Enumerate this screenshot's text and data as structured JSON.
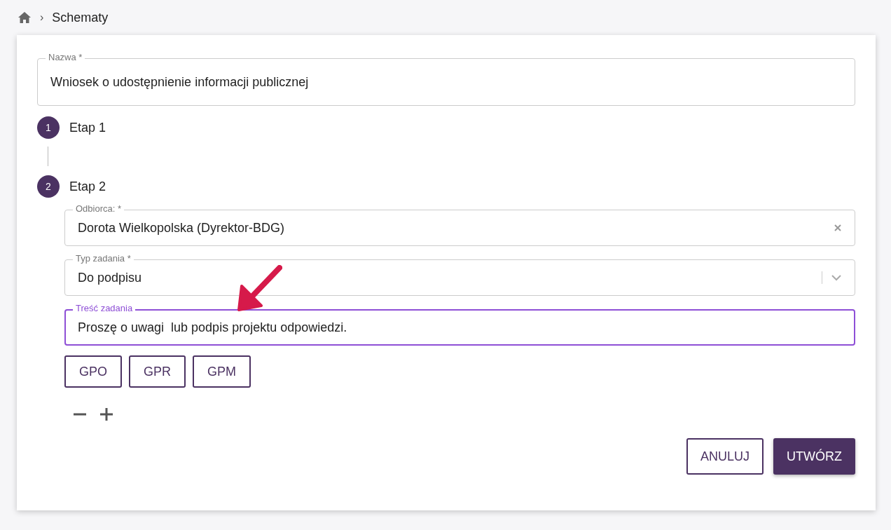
{
  "breadcrumb": {
    "separator": "›",
    "items": [
      {
        "label": "Schematy"
      }
    ]
  },
  "name_field": {
    "label": "Nazwa *",
    "value": "Wniosek o udostępnienie informacji publicznej"
  },
  "steps": [
    {
      "number": "1",
      "label": "Etap 1",
      "expanded": false
    },
    {
      "number": "2",
      "label": "Etap 2",
      "expanded": true,
      "fields": [
        {
          "kind": "clearable",
          "label": "Odbiorca: *",
          "value": "Dorota Wielkopolska (Dyrektor-BDG)",
          "focused": false
        },
        {
          "kind": "select",
          "label": "Typ zadania *",
          "value": "Do podpisu",
          "focused": false
        },
        {
          "kind": "text",
          "label": "Treść zadania",
          "value": "Proszę o uwagi  lub podpis projektu odpowiedzi.",
          "focused": true
        }
      ],
      "tag_buttons": [
        "GPO",
        "GPR",
        "GPM"
      ]
    }
  ],
  "actions": [
    {
      "label": "ANULUJ",
      "kind": "secondary"
    },
    {
      "label": "UTWÓRZ",
      "kind": "primary"
    }
  ]
}
